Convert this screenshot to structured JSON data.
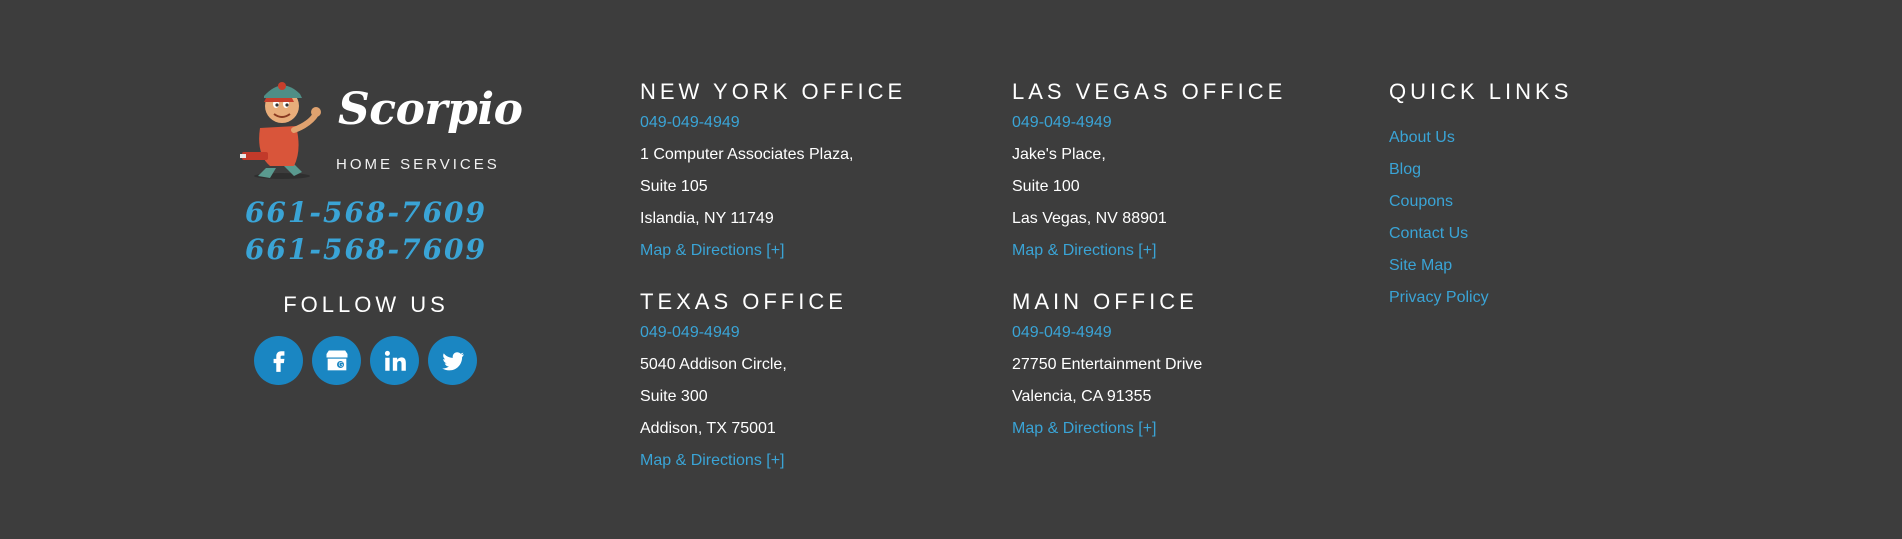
{
  "brand": {
    "name": "Scorpio",
    "tagline": "HOME SERVICES",
    "phones": [
      "661-568-7609",
      "661-568-7609"
    ],
    "follow_label": "FOLLOW US",
    "socials": [
      "facebook-icon",
      "google-business-icon",
      "linkedin-icon",
      "twitter-icon"
    ]
  },
  "offices": [
    {
      "title": "NEW YORK OFFICE",
      "phone": "049-049-4949",
      "address": [
        "1 Computer Associates Plaza,",
        "Suite 105",
        "Islandia, NY 11749"
      ],
      "map_label": "Map & Directions [+]"
    },
    {
      "title": "LAS VEGAS OFFICE",
      "phone": "049-049-4949",
      "address": [
        "Jake's Place,",
        "Suite 100",
        "Las Vegas, NV 88901"
      ],
      "map_label": "Map & Directions [+]"
    },
    {
      "title": "TEXAS OFFICE",
      "phone": "049-049-4949",
      "address": [
        "5040 Addison Circle,",
        "Suite 300",
        "Addison, TX 75001"
      ],
      "map_label": "Map & Directions [+]"
    },
    {
      "title": "MAIN OFFICE",
      "phone": "049-049-4949",
      "address": [
        "27750 Entertainment Drive",
        "Valencia, CA 91355"
      ],
      "map_label": "Map & Directions [+]"
    }
  ],
  "quick_links": {
    "title": "QUICK LINKS",
    "items": [
      "About Us",
      "Blog",
      "Coupons",
      "Contact Us",
      "Site Map",
      "Privacy Policy"
    ]
  },
  "colors": {
    "background": "#3d3d3d",
    "accent": "#3aa4d6",
    "social_bg": "#1a86c2"
  }
}
